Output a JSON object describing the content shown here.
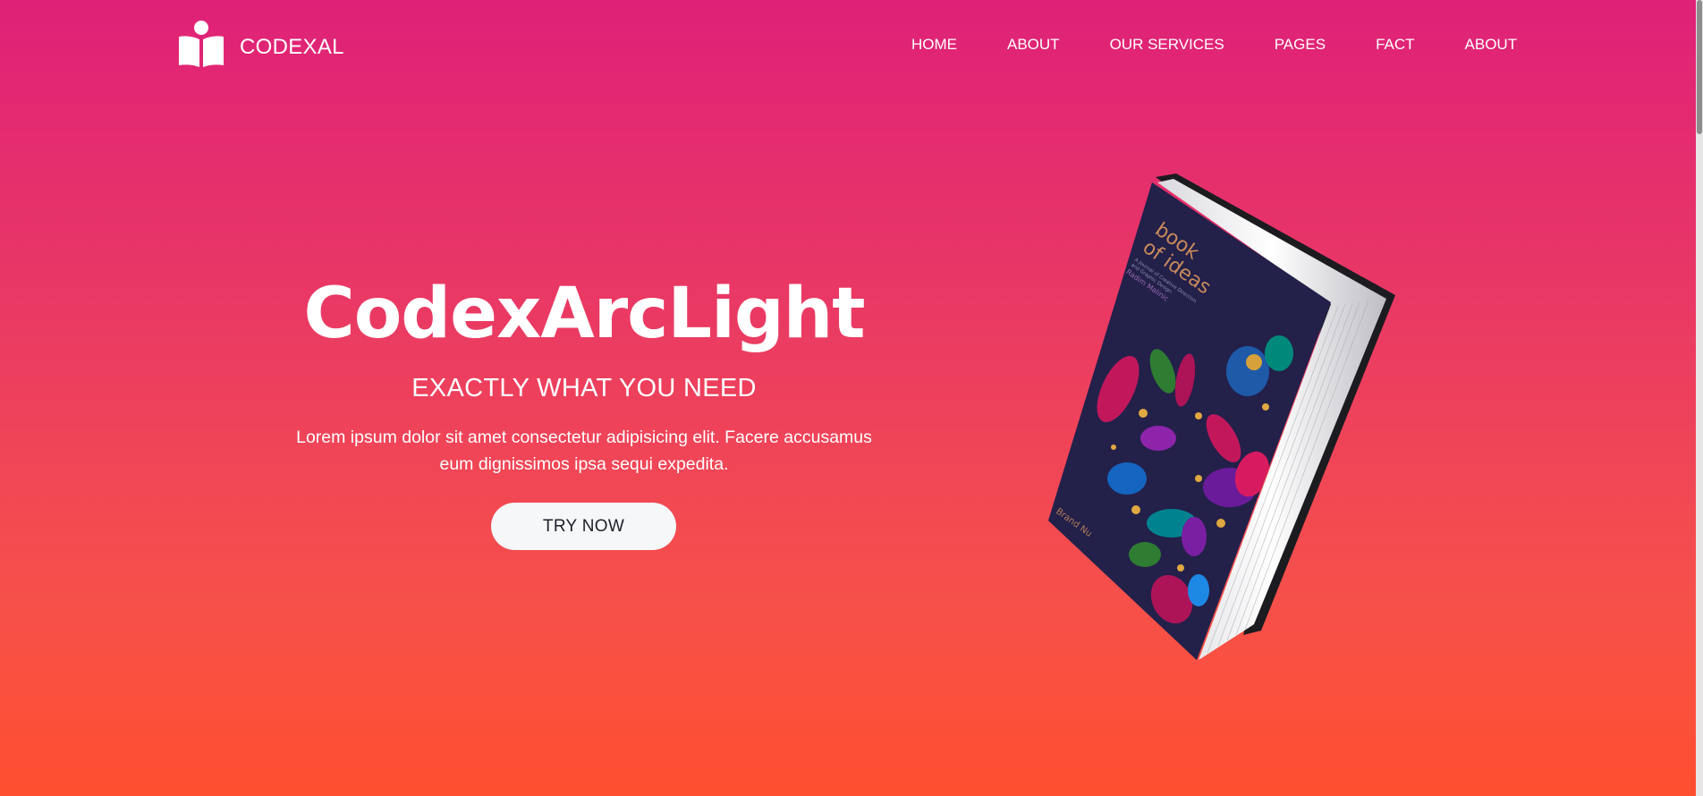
{
  "header": {
    "logo_text": "CODEXAL",
    "nav": [
      "HOME",
      "ABOUT",
      "OUR SERVICES",
      "PAGES",
      "FACT",
      "ABOUT"
    ]
  },
  "hero": {
    "title": "CodexArcLight",
    "subtitle": "EXACTLY WHAT YOU NEED",
    "text_line1": "Lorem ipsum dolor sit amet consectetur adipisicing elit. Facere accusamus",
    "text_line2": "eum dignissimos ipsa sequi expedita.",
    "button_label": "TRY NOW"
  },
  "book": {
    "cover_title_line1": "book",
    "cover_title_line2": "of ideas",
    "cover_small_1": "A Journal of Creative Direction",
    "cover_small_2": "and Graphic Design",
    "cover_small_3": "Radim Malinic",
    "publisher": "Brand Nu"
  },
  "colors": {
    "gradient_top": "#df2178",
    "gradient_bottom": "#ff4f30",
    "button_bg": "#f6f7f9",
    "button_text": "#1e1e28",
    "book_cover": "#23204a",
    "book_title": "#c98a5a"
  }
}
